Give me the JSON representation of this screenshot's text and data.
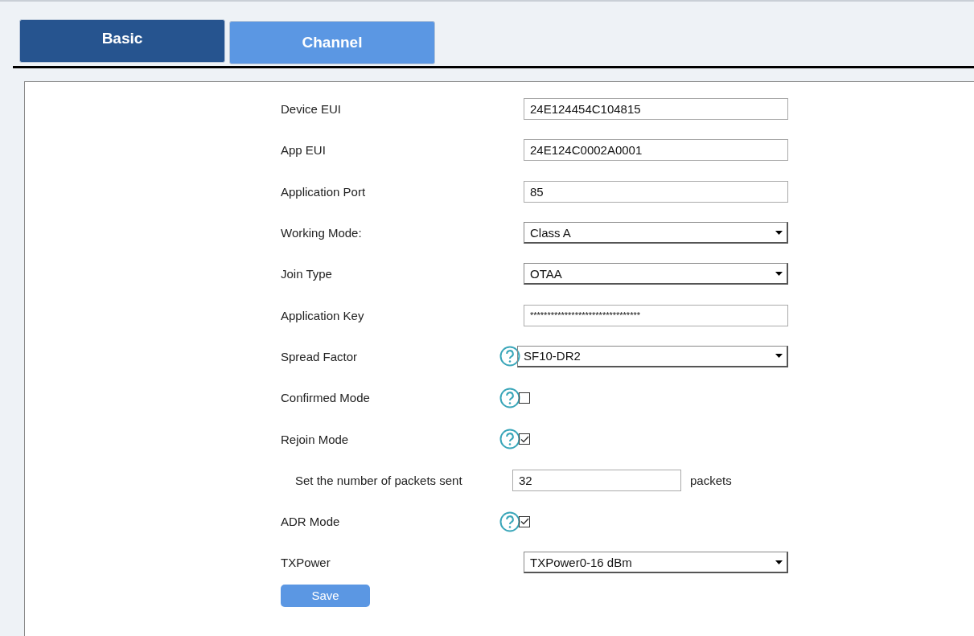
{
  "tabs": [
    {
      "label": "Basic",
      "selected": true
    },
    {
      "label": "Channel",
      "selected": false
    }
  ],
  "fields": [
    {
      "kind": "text",
      "label": "Device EUI",
      "value": "24E124454C104815",
      "help": false
    },
    {
      "kind": "text",
      "label": "App EUI",
      "value": "24E124C0002A0001",
      "help": false
    },
    {
      "kind": "text",
      "label": "Application Port",
      "value": "85",
      "help": false
    },
    {
      "kind": "select",
      "label": "Working Mode:",
      "value": "Class A",
      "help": false
    },
    {
      "kind": "select",
      "label": "Join Type",
      "value": "OTAA",
      "help": false
    },
    {
      "kind": "password",
      "label": "Application Key",
      "value": "********************************",
      "help": false
    },
    {
      "kind": "select",
      "label": "Spread Factor",
      "value": "SF10-DR2",
      "help": true
    },
    {
      "kind": "checkbox",
      "label": "Confirmed Mode",
      "checked": false,
      "help": true
    },
    {
      "kind": "checkbox",
      "label": "Rejoin Mode",
      "checked": true,
      "help": true
    },
    {
      "kind": "sub",
      "label": "Set the number of packets sent",
      "value": "32",
      "unit": "packets",
      "help": false
    },
    {
      "kind": "checkbox",
      "label": "ADR Mode",
      "checked": true,
      "help": true
    },
    {
      "kind": "select",
      "label": "TXPower",
      "value": "TXPower0-16 dBm",
      "help": false
    }
  ],
  "save_button": "Save"
}
